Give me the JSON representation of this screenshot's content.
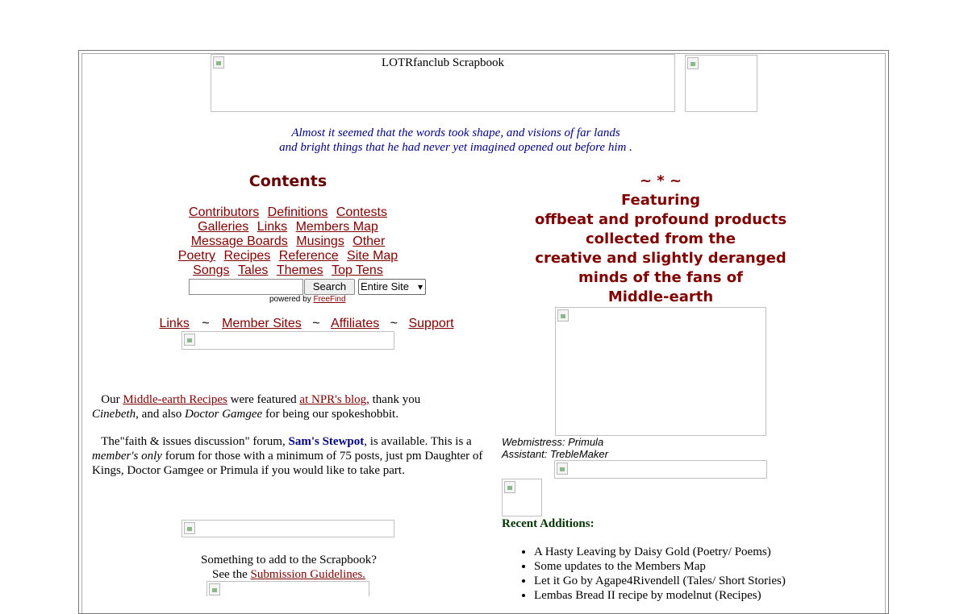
{
  "header": {
    "banner_alt": "LOTRfanclub Scrapbook",
    "quote_line1": "Almost it seemed that the words took shape, and visions of far lands",
    "quote_line2": "and bright things that he had never yet imagined opened out before him ."
  },
  "contents": {
    "title": "Contents",
    "rows": [
      [
        "Contributors",
        "Definitions",
        "Contests"
      ],
      [
        "Galleries",
        "Links",
        "Members Map"
      ],
      [
        "Message Boards",
        "Musings",
        "Other"
      ],
      [
        "Poetry",
        "Recipes",
        "Reference",
        "Site Map"
      ],
      [
        "Songs",
        "Tales",
        "Themes",
        "Top Tens"
      ]
    ]
  },
  "search": {
    "input_value": "",
    "button_label": "Search",
    "scope_selected": "Entire Site",
    "powered_by": "powered by",
    "powered_link": "FreeFind"
  },
  "secondary_nav": {
    "links": [
      "Links",
      "Member Sites",
      "Affiliates",
      "Support"
    ],
    "separator": "~"
  },
  "news": {
    "p1": {
      "prefix": "Our ",
      "link1": "Middle-earth Recipes",
      "mid1": " were featured ",
      "link2": "at NPR's blog,",
      "mid2": " thank you",
      "name1": "Cinebeth",
      "mid3": ", and also ",
      "name2": "Doctor Gamgee",
      "suffix": " for being our spokeshobbit."
    },
    "p2": {
      "prefix": "The\"faith & issues discussion\" forum, ",
      "forum": "Sam's Stewpot",
      "mid1": ", is available.  This is a ",
      "members_only": "member's only",
      "rest": " forum for those with a minimum of 75 posts, just pm Daughter of Kings, Doctor Gamgee or Primula if you would like to take part."
    }
  },
  "submit": {
    "line1": "Something to add to the Scrapbook?",
    "line2_prefix": "See the ",
    "line2_link": "Submission Guidelines."
  },
  "featuring": {
    "ornament": "~ * ~",
    "lines": [
      "Featuring",
      "offbeat and profound products",
      "collected from the",
      "creative and slightly deranged",
      "minds of the fans of",
      "Middle-earth"
    ]
  },
  "staff": {
    "webmistress": "Webmistress: Primula",
    "assistant": "Assistant: TrebleMaker"
  },
  "recent": {
    "title": "Recent Additions:",
    "items": [
      "A Hasty Leaving by Daisy Gold (Poetry/ Poems)",
      "Some updates to the Members Map",
      "Let it Go by Agape4Rivendell (Tales/ Short Stories)",
      "Lembas Bread II recipe by modelnut (Recipes)"
    ]
  },
  "colors": {
    "link": "#800000",
    "quote": "#000080",
    "heading": "#660000",
    "recent": "#003300"
  }
}
